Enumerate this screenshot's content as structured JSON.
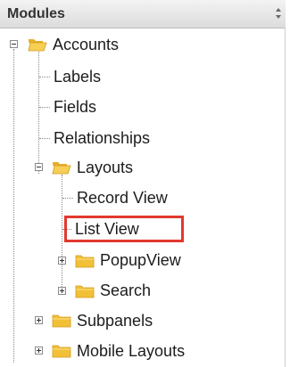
{
  "header": {
    "title": "Modules"
  },
  "tree": {
    "accounts": "Accounts",
    "labels": "Labels",
    "fields": "Fields",
    "relationships": "Relationships",
    "layouts": "Layouts",
    "record_view": "Record View",
    "list_view": "List View",
    "popup_view": "PopupView",
    "search": "Search",
    "subpanels": "Subpanels",
    "mobile_layouts": "Mobile Layouts"
  },
  "colors": {
    "highlight": "#e2382f",
    "folder": "#f2c037"
  }
}
